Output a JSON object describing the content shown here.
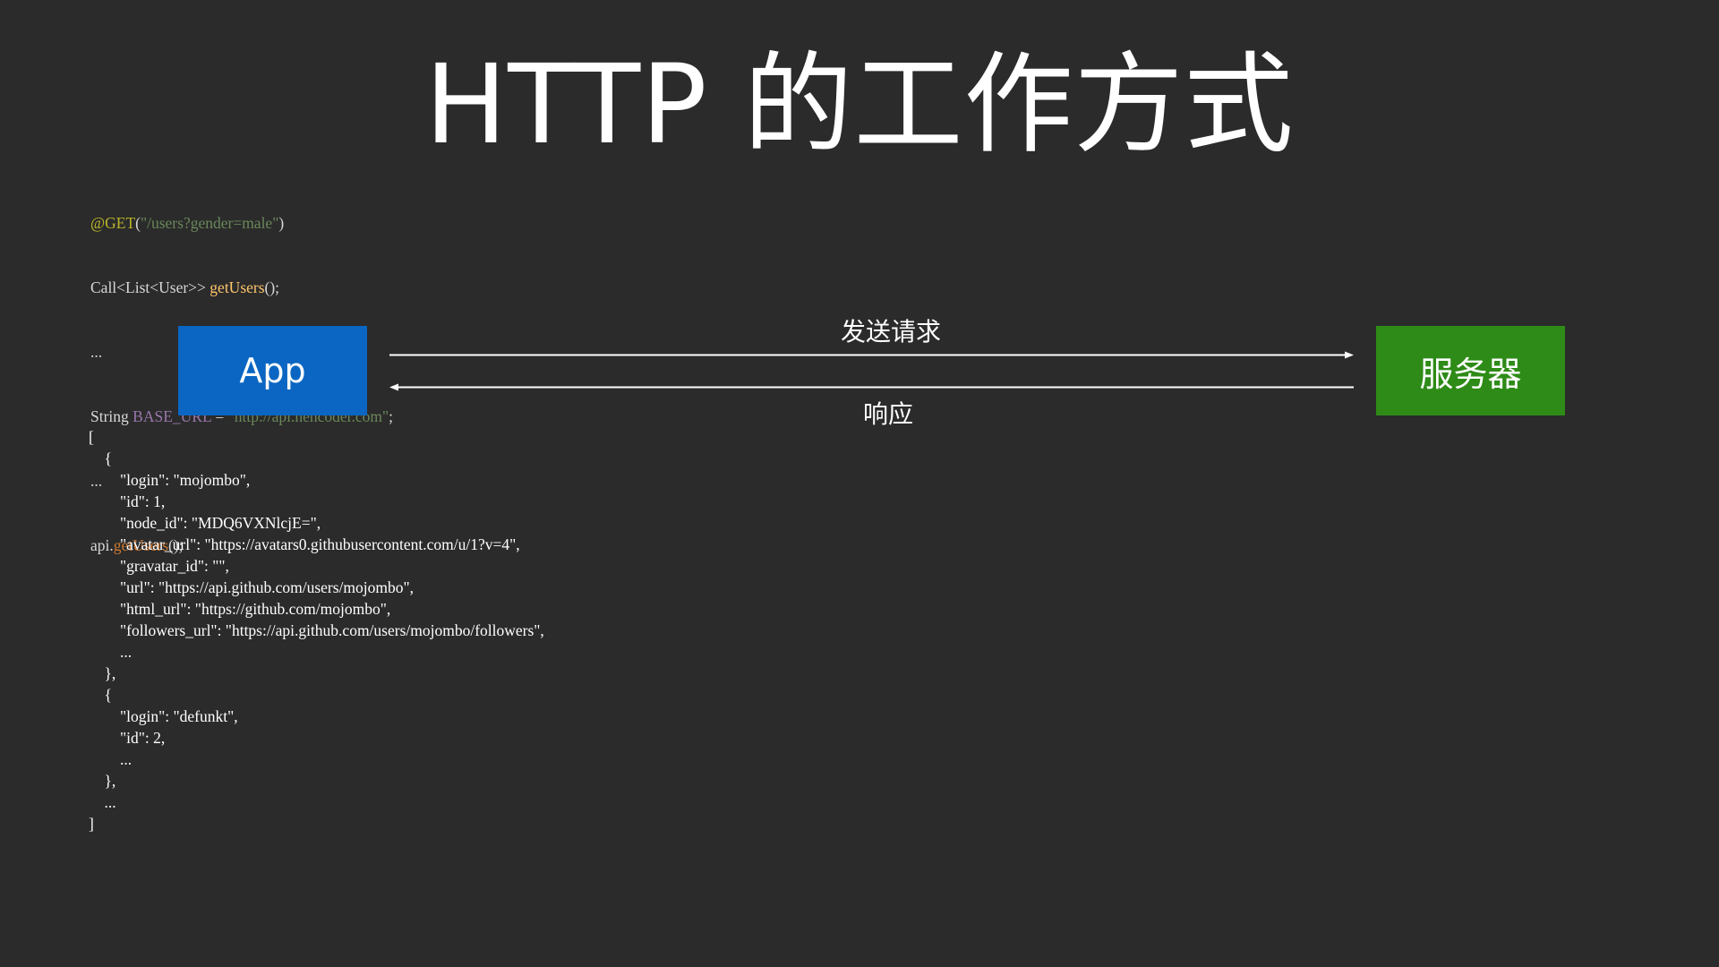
{
  "title": "HTTP 的工作方式",
  "code_top": {
    "line1": {
      "annotation": "@GET",
      "open": "(",
      "path": "\"/users?gender=male\"",
      "close": ")"
    },
    "line2": {
      "type": "Call<List<User>> ",
      "method": "getUsers",
      "suffix": "();"
    },
    "line3": "...",
    "line4": {
      "prefix": "String ",
      "field": "BASE_URL",
      "eq": " = ",
      "value": "\"http://api.hencoder.com\"",
      "suffix": ";"
    },
    "line5": "...",
    "line6": {
      "prefix": "api.",
      "call": "getUsers",
      "suffix": "();"
    }
  },
  "diagram": {
    "client_label": "App",
    "server_label": "服务器",
    "request_label": "发送请求",
    "response_label": "响应",
    "client_color": "#0a66c2",
    "server_color": "#2e8b17"
  },
  "json_lines": [
    "[",
    "    {",
    "        \"login\": \"mojombo\",",
    "        \"id\": 1,",
    "        \"node_id\": \"MDQ6VXNlcjE=\",",
    "        \"avatar_url\": \"https://avatars0.githubusercontent.com/u/1?v=4\",",
    "        \"gravatar_id\": \"\",",
    "        \"url\": \"https://api.github.com/users/mojombo\",",
    "        \"html_url\": \"https://github.com/mojombo\",",
    "        \"followers_url\": \"https://api.github.com/users/mojombo/followers\",",
    "        ...",
    "    },",
    "    {",
    "        \"login\": \"defunkt\",",
    "        \"id\": 2,",
    "        ...",
    "    },",
    "    ...",
    "]"
  ]
}
